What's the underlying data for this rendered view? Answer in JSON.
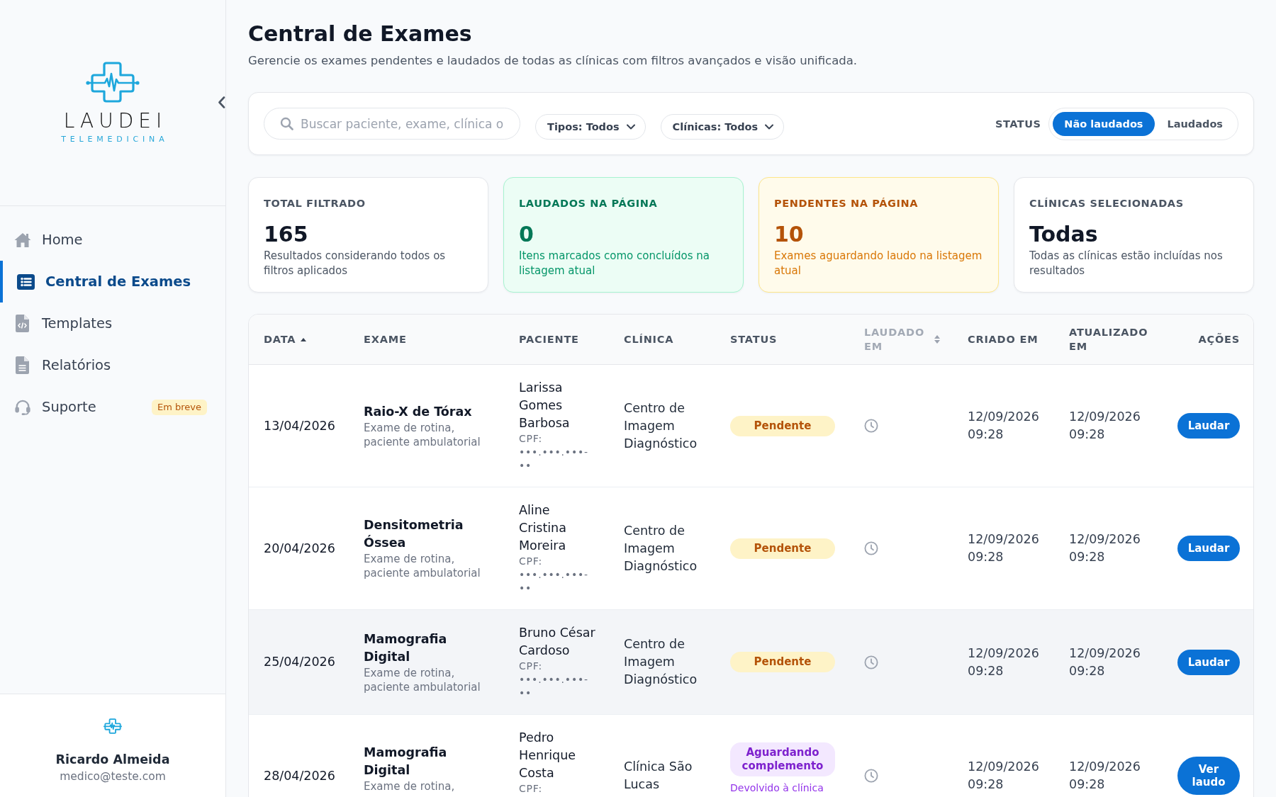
{
  "sidebar": {
    "logo": {
      "name": "LAUDEI",
      "tagline": "TELEMEDICINA"
    },
    "items": [
      {
        "label": "Home",
        "selected": false
      },
      {
        "label": "Central de Exames",
        "selected": true
      },
      {
        "label": "Templates",
        "selected": false
      },
      {
        "label": "Relatórios",
        "selected": false
      },
      {
        "label": "Suporte",
        "selected": false,
        "badge": "Em breve"
      }
    ],
    "user": {
      "name": "Ricardo Almeida",
      "email": "medico@teste.com"
    }
  },
  "header": {
    "title": "Central de Exames",
    "subtitle": "Gerencie os exames pendentes e laudados de todas as clínicas com filtros avançados e visão unificada."
  },
  "filters": {
    "search": {
      "placeholder": "Buscar paciente, exame, clínica o"
    },
    "dropdowns": [
      "Tipos: Todos",
      "Clínicas: Todos"
    ],
    "status": {
      "label": "STATUS",
      "options": [
        {
          "label": "Não laudados",
          "selected": true
        },
        {
          "label": "Laudados",
          "selected": false
        }
      ]
    }
  },
  "stats": [
    {
      "kind": "neutral",
      "label": "TOTAL FILTRADO",
      "value": "165",
      "description": "Resultados considerando todos os filtros aplicados"
    },
    {
      "kind": "success",
      "label": "LAUDADOS NA PÁGINA",
      "value": "0",
      "description": "Itens marcados como concluídos na listagem atual"
    },
    {
      "kind": "warning",
      "label": "PENDENTES NA PÁGINA",
      "value": "10",
      "description": "Exames aguardando laudo na listagem atual"
    },
    {
      "kind": "neutral",
      "label": "CLÍNICAS SELECIONADAS",
      "value": "Todas",
      "description": "Todas as clínicas estão incluídas nos resultados"
    }
  ],
  "table": {
    "columns": [
      {
        "label": "DATA",
        "kind": "sorted",
        "muted": false
      },
      {
        "label": "EXAME",
        "kind": "plain",
        "muted": false
      },
      {
        "label": "PACIENTE",
        "kind": "plain",
        "muted": false
      },
      {
        "label": "CLÍNICA",
        "kind": "plain",
        "muted": false
      },
      {
        "label": "STATUS",
        "kind": "plain",
        "muted": false
      },
      {
        "label": "LAUDADO EM",
        "kind": "sortable",
        "muted": true
      },
      {
        "label": "CRIADO EM",
        "kind": "plain",
        "muted": false
      },
      {
        "label": "ATUALIZADO EM",
        "kind": "plain",
        "muted": false
      },
      {
        "label": "AÇÕES",
        "kind": "plain",
        "muted": false
      }
    ],
    "rows": [
      {
        "date": "13/04/2026",
        "exam": {
          "name": "Raio-X de Tórax",
          "description": "Exame de rotina, paciente ambulatorial"
        },
        "patient": {
          "name": "Larissa Gomes Barbosa",
          "cpf": "CPF: •••.•••.•••-••"
        },
        "clinic": "Centro de Imagem Diagnóstico",
        "status": {
          "label": "Pendente",
          "kind": "pending"
        },
        "created": "12/09/2026 09:28",
        "updated": "12/09/2026 09:28",
        "action": "Laudar",
        "hovered": false
      },
      {
        "date": "20/04/2026",
        "exam": {
          "name": "Densitometria Óssea",
          "description": "Exame de rotina, paciente ambulatorial"
        },
        "patient": {
          "name": "Aline Cristina Moreira",
          "cpf": "CPF: •••.•••.•••-••"
        },
        "clinic": "Centro de Imagem Diagnóstico",
        "status": {
          "label": "Pendente",
          "kind": "pending"
        },
        "created": "12/09/2026 09:28",
        "updated": "12/09/2026 09:28",
        "action": "Laudar",
        "hovered": false
      },
      {
        "date": "25/04/2026",
        "exam": {
          "name": "Mamografia Digital",
          "description": "Exame de rotina, paciente ambulatorial"
        },
        "patient": {
          "name": "Bruno César Cardoso",
          "cpf": "CPF: •••.•••.•••-••"
        },
        "clinic": "Centro de Imagem Diagnóstico",
        "status": {
          "label": "Pendente",
          "kind": "pending"
        },
        "created": "12/09/2026 09:28",
        "updated": "12/09/2026 09:28",
        "action": "Laudar",
        "hovered": true
      },
      {
        "date": "28/04/2026",
        "exam": {
          "name": "Mamografia Digital",
          "description": "Exame de rotina,"
        },
        "patient": {
          "name": "Pedro Henrique Costa",
          "cpf": "CPF:"
        },
        "clinic": "Clínica São Lucas",
        "status": {
          "label": "Aguardando complemento",
          "kind": "awaiting",
          "note": "Devolvido à clínica"
        },
        "created": "12/09/2026 09:28",
        "updated": "12/09/2026 09:28",
        "action": "Ver laudo",
        "hovered": false
      }
    ]
  }
}
